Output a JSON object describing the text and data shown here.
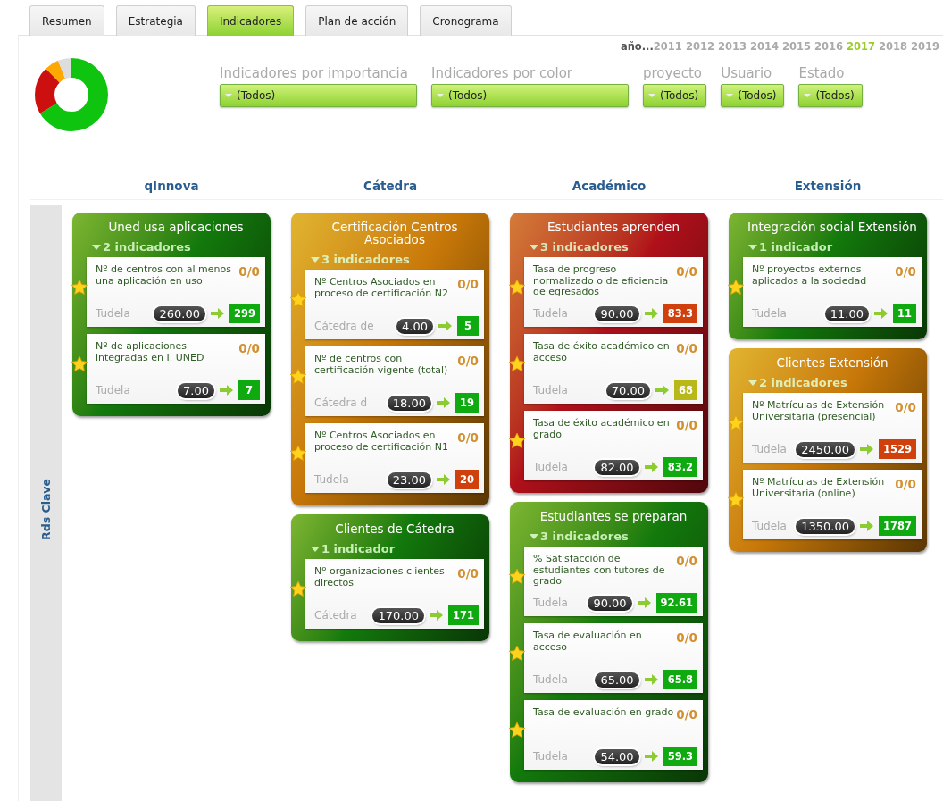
{
  "tabs": [
    {
      "label": "Resumen",
      "selected": false
    },
    {
      "label": "Estrategia",
      "selected": false
    },
    {
      "label": "Indicadores",
      "selected": true
    },
    {
      "label": "Plan de acción",
      "selected": false
    },
    {
      "label": "Cronograma",
      "selected": false
    }
  ],
  "years": {
    "prefix": "año...",
    "items": [
      {
        "label": "2011",
        "selected": false
      },
      {
        "label": "2012",
        "selected": false
      },
      {
        "label": "2013",
        "selected": false
      },
      {
        "label": "2014",
        "selected": false
      },
      {
        "label": "2015",
        "selected": false
      },
      {
        "label": "2016",
        "selected": false
      },
      {
        "label": "2017",
        "selected": true
      },
      {
        "label": "2018",
        "selected": false
      },
      {
        "label": "2019",
        "selected": false
      }
    ]
  },
  "filters": [
    {
      "label": "Indicadores por importancia",
      "value": "(Todos)",
      "kind": "wide"
    },
    {
      "label": "Indicadores por color",
      "value": "(Todos)",
      "kind": "wide"
    },
    {
      "label": "proyecto",
      "value": "(Todos)",
      "kind": "narrow"
    },
    {
      "label": "Usuario",
      "value": "(Todos)",
      "kind": "narrow"
    },
    {
      "label": "Estado",
      "value": "(Todos)",
      "kind": "narrow"
    }
  ],
  "row_label": "Rds Clave",
  "columns": [
    {
      "title": "qInnova",
      "groups": [
        {
          "title": "Uned usa aplicaciones",
          "color": "#137a0c",
          "count": "2 indicadores",
          "indicators": [
            {
              "name": "Nº de centros con al menos una aplicación en uso",
              "score": "0/0",
              "owner": "Tudela",
              "target": "260.00",
              "result": "299",
              "color": "#0faa10"
            },
            {
              "name": "Nº de aplicaciones integradas en I. UNED",
              "score": "0/0",
              "owner": "Tudela",
              "target": "7.00",
              "result": "7",
              "color": "#0faa10"
            }
          ]
        }
      ]
    },
    {
      "title": "Cátedra",
      "groups": [
        {
          "title": "Certificación Centros Asociados",
          "color": "#c87808",
          "count": "3 indicadores",
          "indicators": [
            {
              "name": "Nº Centros Asociados en proceso de certificación N2",
              "score": "0/0",
              "owner": "Cátedra de",
              "target": "4.00",
              "result": "5",
              "color": "#0faa10"
            },
            {
              "name": "Nº de centros con certificación vigente (total)",
              "score": "0/0",
              "owner": "Cátedra d",
              "target": "18.00",
              "result": "19",
              "color": "#0faa10"
            },
            {
              "name": "Nº Centros Asociados en proceso de certificación N1",
              "score": "0/0",
              "owner": "Tudela",
              "target": "23.00",
              "result": "20",
              "color": "#d0400c"
            }
          ]
        },
        {
          "title": "Clientes de Cátedra",
          "color": "#137a0c",
          "count": "1 indicador",
          "indicators": [
            {
              "name": "Nº organizaciones clientes directos",
              "score": "0/0",
              "owner": "Cátedra",
              "target": "170.00",
              "result": "171",
              "color": "#0faa10"
            }
          ]
        }
      ]
    },
    {
      "title": "Académico",
      "groups": [
        {
          "title": "Estudiantes aprenden",
          "color": "#b0101a",
          "count": "3 indicadores",
          "indicators": [
            {
              "name": "Tasa de progreso normalizado o de eficiencia de egresados",
              "score": "0/0",
              "owner": "Tudela",
              "target": "90.00",
              "result": "83.3",
              "color": "#d0400c"
            },
            {
              "name": "Tasa de éxito académico en acceso",
              "score": "0/0",
              "owner": "Tudela",
              "target": "70.00",
              "result": "68",
              "color": "#b8b818"
            },
            {
              "name": "Tasa de éxito académico en grado",
              "score": "0/0",
              "owner": "Tudela",
              "target": "82.00",
              "result": "83.2",
              "color": "#0faa10"
            }
          ]
        },
        {
          "title": "Estudiantes se preparan",
          "color": "#137a0c",
          "count": "3 indicadores",
          "indicators": [
            {
              "name": "% Satisfacción de estudiantes con tutores de grado",
              "score": "0/0",
              "owner": "Tudela",
              "target": "90.00",
              "result": "92.61",
              "color": "#0faa10"
            },
            {
              "name": "Tasa de evaluación en acceso",
              "score": "0/0",
              "owner": "Tudela",
              "target": "65.00",
              "result": "65.8",
              "color": "#0faa10"
            },
            {
              "name": "Tasa de evaluación en grado",
              "score": "0/0",
              "owner": "Tudela",
              "target": "54.00",
              "result": "59.3",
              "color": "#0faa10"
            }
          ]
        }
      ]
    },
    {
      "title": "Extensión",
      "groups": [
        {
          "title": "Integración social Extensión",
          "color": "#137a0c",
          "count": "1 indicador",
          "indicators": [
            {
              "name": "Nº proyectos externos aplicados a la sociedad",
              "score": "0/0",
              "owner": "Tudela",
              "target": "11.00",
              "result": "11",
              "color": "#0faa10"
            }
          ]
        },
        {
          "title": "Clientes Extensión",
          "color": "#c87808",
          "count": "2 indicadores",
          "indicators": [
            {
              "name": "Nº Matrículas de Extensión Universitaria (presencial)",
              "score": "0/0",
              "owner": "Tudela",
              "target": "2450.00",
              "result": "1529",
              "color": "#d0400c"
            },
            {
              "name": "Nº Matrículas de Extensión Universitaria (online)",
              "score": "0/0",
              "owner": "Tudela",
              "target": "1350.00",
              "result": "1787",
              "color": "#0faa10"
            }
          ]
        }
      ]
    }
  ]
}
